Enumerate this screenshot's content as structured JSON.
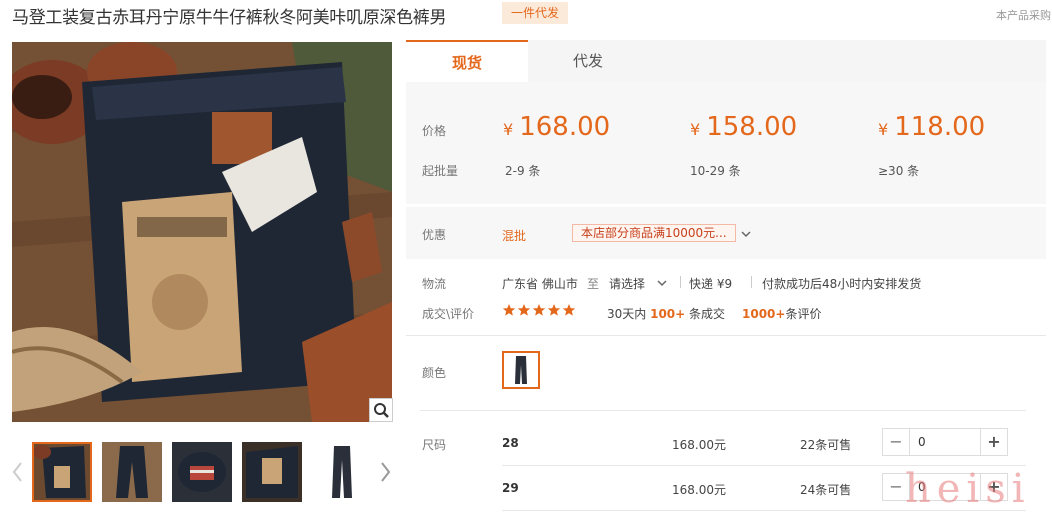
{
  "product": {
    "title": "马登工装复古赤耳丹宁原牛牛仔裤秋冬阿美咔叽原深色裤男",
    "badge": "一件代发",
    "note": "本产品采购"
  },
  "tabs": [
    {
      "label": "现货",
      "active": true
    },
    {
      "label": "代发",
      "active": false
    }
  ],
  "price": {
    "price_label": "价格",
    "moq_label": "起批量",
    "currency": "¥",
    "tiers": [
      {
        "price": "168.00",
        "qty": "2-9 条"
      },
      {
        "price": "158.00",
        "qty": "10-29 条"
      },
      {
        "price": "118.00",
        "qty": "≥30 条"
      }
    ]
  },
  "promo": {
    "label": "优惠",
    "tag": "混批",
    "text": "本店部分商品满10000元..."
  },
  "logistics": {
    "label": "物流",
    "from": "广东省 佛山市",
    "to_word": "至",
    "dest": "请选择",
    "express": "快递 ¥9",
    "ship_note": "付款成功后48小时内安排发货"
  },
  "reviews": {
    "label": "成交\\评价",
    "stars": 5,
    "sold_prefix": "30天内",
    "sold_count": "100+",
    "sold_suffix": "条成交",
    "review_count": "1000+",
    "review_suffix": "条评价"
  },
  "color": {
    "label": "颜色"
  },
  "sizes": {
    "label": "尺码",
    "rows": [
      {
        "size": "28",
        "price": "168.00元",
        "stock": "22条可售",
        "qty": "0"
      },
      {
        "size": "29",
        "price": "168.00元",
        "stock": "24条可售",
        "qty": "0"
      }
    ]
  },
  "watermark": "heisi",
  "colors": {
    "accent": "#e4681c",
    "panel": "#f7f7f7"
  }
}
